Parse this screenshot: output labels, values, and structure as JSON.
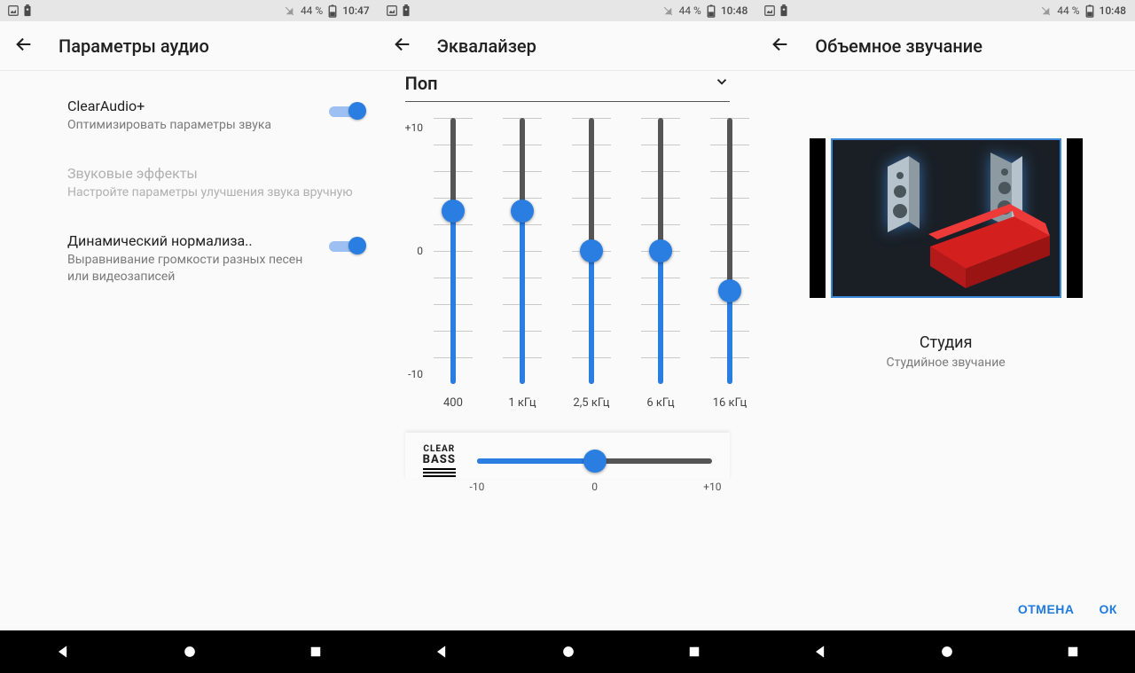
{
  "status": {
    "battery_pct": "44 %",
    "time1": "10:47",
    "time2": "10:48",
    "time3": "10:48"
  },
  "screen1": {
    "title": "Параметры аудио",
    "clearaudio": {
      "title": "ClearAudio+",
      "sub": "Оптимизировать параметры звука"
    },
    "effects": {
      "title": "Звуковые эффекты",
      "sub": "Настройте параметры улучшения звука вручную"
    },
    "normalize": {
      "title": "Динамический нормализа..",
      "sub": "Выравнивание громкости разных песен или видеозаписей"
    }
  },
  "screen2": {
    "title": "Эквалайзер",
    "preset": "Поп",
    "scale": {
      "max": "+10",
      "mid": "0",
      "min": "-10"
    },
    "bands": [
      {
        "label": "400",
        "value": 3
      },
      {
        "label": "1 кГц",
        "value": 3
      },
      {
        "label": "2,5 кГц",
        "value": 0
      },
      {
        "label": "6 кГц",
        "value": 0
      },
      {
        "label": "16 кГц",
        "value": -3
      }
    ],
    "bass": {
      "label_top": "CLEAR",
      "label_bot": "BASS",
      "min": "-10",
      "mid": "0",
      "max": "+10",
      "value": 0
    }
  },
  "screen3": {
    "title": "Объемное звучание",
    "preset_name": "Студия",
    "preset_desc": "Студийное звучание",
    "cancel": "ОТМЕНА",
    "ok": "ОК"
  },
  "nav": {
    "back": "back",
    "home": "home",
    "recent": "recent"
  }
}
